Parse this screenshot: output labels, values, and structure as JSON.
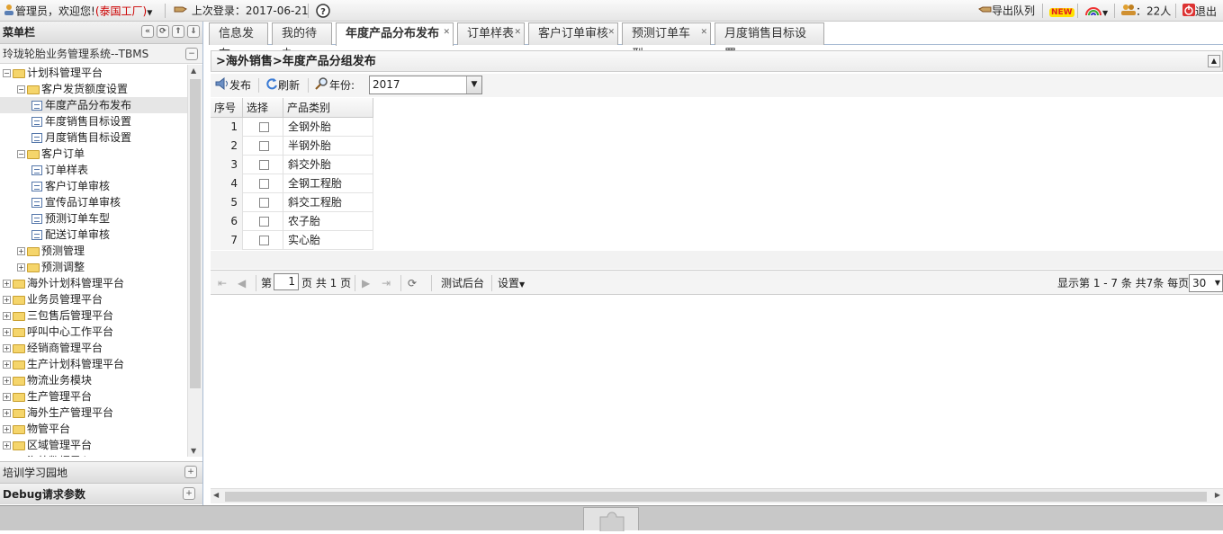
{
  "topbar": {
    "user": "管理员，欢迎您!",
    "factory": "(泰国工厂)",
    "last_login_label": "上次登录：",
    "last_login_date": "2017-06-21",
    "export_queue": "导出队列",
    "new_badge": "NEW",
    "online_count": "22人",
    "online_sep": "：",
    "logout": "退出"
  },
  "sidebar": {
    "title": "菜单栏",
    "system": "玲珑轮胎业务管理系统--TBMS",
    "tree": [
      {
        "label": "计划科管理平台",
        "level": 0,
        "type": "folder",
        "open": true
      },
      {
        "label": "客户发货额度设置",
        "level": 1,
        "type": "folder",
        "open": true
      },
      {
        "label": "年度产品分布发布",
        "level": 2,
        "type": "leaf",
        "selected": true
      },
      {
        "label": "年度销售目标设置",
        "level": 2,
        "type": "leaf"
      },
      {
        "label": "月度销售目标设置",
        "level": 2,
        "type": "leaf"
      },
      {
        "label": "客户订单",
        "level": 1,
        "type": "folder",
        "open": true
      },
      {
        "label": "订单样表",
        "level": 2,
        "type": "leaf"
      },
      {
        "label": "客户订单审核",
        "level": 2,
        "type": "leaf"
      },
      {
        "label": "宣传品订单审核",
        "level": 2,
        "type": "leaf"
      },
      {
        "label": "预测订单车型",
        "level": 2,
        "type": "leaf"
      },
      {
        "label": "配送订单审核",
        "level": 2,
        "type": "leaf"
      },
      {
        "label": "预测管理",
        "level": 1,
        "type": "folder",
        "open": false
      },
      {
        "label": "预测调整",
        "level": 1,
        "type": "folder",
        "open": false
      },
      {
        "label": "海外计划科管理平台",
        "level": 0,
        "type": "folder",
        "open": false
      },
      {
        "label": "业务员管理平台",
        "level": 0,
        "type": "folder",
        "open": false
      },
      {
        "label": "三包售后管理平台",
        "level": 0,
        "type": "folder",
        "open": false
      },
      {
        "label": "呼叫中心工作平台",
        "level": 0,
        "type": "folder",
        "open": false
      },
      {
        "label": "经销商管理平台",
        "level": 0,
        "type": "folder",
        "open": false
      },
      {
        "label": "生产计划科管理平台",
        "level": 0,
        "type": "folder",
        "open": false
      },
      {
        "label": "物流业务模块",
        "level": 0,
        "type": "folder",
        "open": false
      },
      {
        "label": "生产管理平台",
        "level": 0,
        "type": "folder",
        "open": false
      },
      {
        "label": "海外生产管理平台",
        "level": 0,
        "type": "folder",
        "open": false
      },
      {
        "label": "物管平台",
        "level": 0,
        "type": "folder",
        "open": false
      },
      {
        "label": "区域管理平台",
        "level": 0,
        "type": "folder",
        "open": false
      },
      {
        "label": "海外数据导入",
        "level": 0,
        "type": "folder",
        "open": false
      }
    ],
    "section_training": "培训学习园地",
    "section_debug": "Debug请求参数"
  },
  "tabs": [
    {
      "label": "信息发布",
      "closable": false
    },
    {
      "label": "我的待办",
      "closable": false
    },
    {
      "label": "年度产品分布发布",
      "closable": true,
      "active": true
    },
    {
      "label": "订单样表",
      "closable": true
    },
    {
      "label": "客户订单审核",
      "closable": true
    },
    {
      "label": "预测订单车型",
      "closable": true
    },
    {
      "label": "月度销售目标设置",
      "closable": false
    }
  ],
  "breadcrumb": ">海外销售>年度产品分组发布",
  "toolbar": {
    "publish": "发布",
    "refresh": "刷新",
    "year_label": "年份:",
    "year_value": "2017"
  },
  "grid": {
    "headers": [
      "序号",
      "选择",
      "产品类别"
    ],
    "rows": [
      {
        "no": "1",
        "category": "全钢外胎"
      },
      {
        "no": "2",
        "category": "半钢外胎"
      },
      {
        "no": "3",
        "category": "斜交外胎"
      },
      {
        "no": "4",
        "category": "全钢工程胎"
      },
      {
        "no": "5",
        "category": "斜交工程胎"
      },
      {
        "no": "6",
        "category": "农子胎"
      },
      {
        "no": "7",
        "category": "实心胎"
      }
    ]
  },
  "pager": {
    "page_prefix": "第",
    "page_value": "1",
    "page_suffix": "页 共 1 页",
    "test_backend": "测试后台",
    "settings": "设置",
    "summary": "显示第 1 - 7 条 共7条  每页:",
    "per_page": "30"
  }
}
